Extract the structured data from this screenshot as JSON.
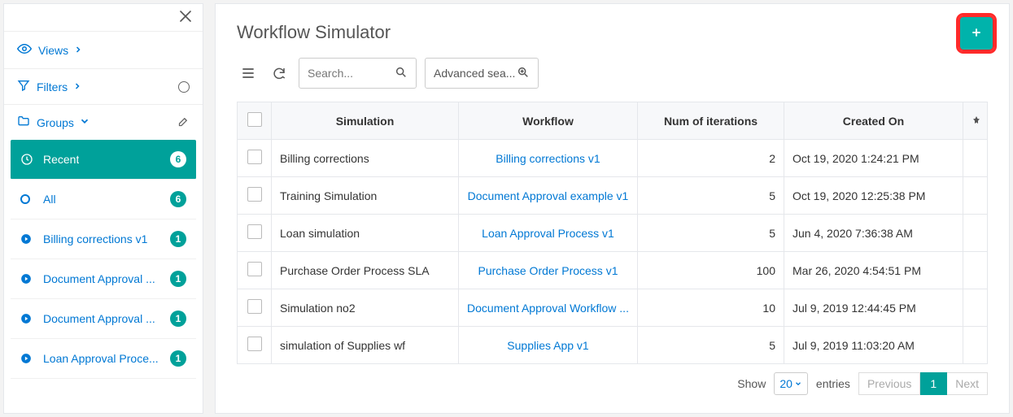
{
  "sidebar": {
    "views_label": "Views",
    "filters_label": "Filters",
    "groups_label": "Groups",
    "items": [
      {
        "label": "Recent",
        "count": "6",
        "kind": "recent",
        "active": true
      },
      {
        "label": "All",
        "count": "6",
        "kind": "all",
        "active": false
      },
      {
        "label": "Billing corrections v1",
        "count": "1",
        "kind": "wf",
        "active": false
      },
      {
        "label": "Document Approval ...",
        "count": "1",
        "kind": "wf",
        "active": false
      },
      {
        "label": "Document Approval ...",
        "count": "1",
        "kind": "wf",
        "active": false
      },
      {
        "label": "Loan Approval Proce...",
        "count": "1",
        "kind": "wf",
        "active": false
      }
    ]
  },
  "main": {
    "title": "Workflow Simulator",
    "search_placeholder": "Search...",
    "advanced_label": "Advanced sea...",
    "columns": {
      "simulation": "Simulation",
      "workflow": "Workflow",
      "iterations": "Num of iterations",
      "created_on": "Created On"
    },
    "rows": [
      {
        "simulation": "Billing corrections",
        "workflow": "Billing corrections v1",
        "iterations": "2",
        "created_on": "Oct 19, 2020 1:24:21 PM"
      },
      {
        "simulation": "Training Simulation",
        "workflow": "Document Approval example v1",
        "iterations": "5",
        "created_on": "Oct 19, 2020 12:25:38 PM"
      },
      {
        "simulation": "Loan simulation",
        "workflow": "Loan Approval Process v1",
        "iterations": "5",
        "created_on": "Jun 4, 2020 7:36:38 AM"
      },
      {
        "simulation": "Purchase Order Process SLA",
        "workflow": "Purchase Order Process v1",
        "iterations": "100",
        "created_on": "Mar 26, 2020 4:54:51 PM"
      },
      {
        "simulation": "Simulation no2",
        "workflow": "Document Approval Workflow ...",
        "iterations": "10",
        "created_on": "Jul 9, 2019 12:44:45 PM"
      },
      {
        "simulation": "simulation of Supplies wf",
        "workflow": "Supplies App v1",
        "iterations": "5",
        "created_on": "Jul 9, 2019 11:03:20 AM"
      }
    ],
    "pager": {
      "show_label": "Show",
      "page_size": "20",
      "entries_label": "entries",
      "prev_label": "Previous",
      "current_page": "1",
      "next_label": "Next"
    }
  }
}
